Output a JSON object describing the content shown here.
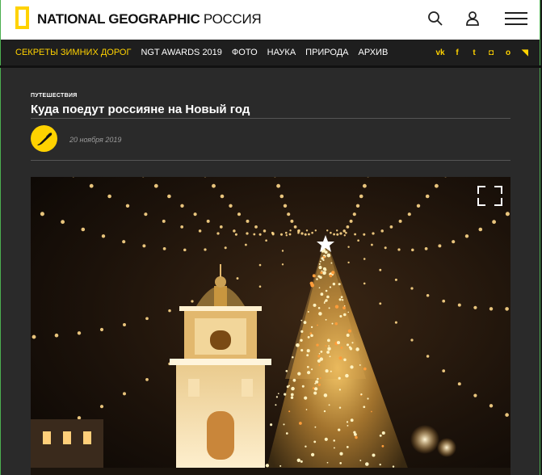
{
  "header": {
    "logo_main": "NATIONAL GEOGRAPHIC",
    "logo_region": "РОССИЯ",
    "colors": {
      "brand_yellow": "#ffd200",
      "nav_bg": "#1e1e1e",
      "content_bg": "#2a2a2a"
    },
    "icons": [
      "search-icon",
      "user-icon",
      "hamburger-menu-icon"
    ]
  },
  "nav": {
    "items": [
      {
        "label": "СЕКРЕТЫ ЗИМНИХ ДОРОГ",
        "active": true
      },
      {
        "label": "NGT AWARDS 2019"
      },
      {
        "label": "ФОТО"
      },
      {
        "label": "НАУКА"
      },
      {
        "label": "ПРИРОДА"
      },
      {
        "label": "АРХИВ"
      }
    ],
    "social": [
      {
        "icon": "vk-icon",
        "glyph": "vk"
      },
      {
        "icon": "facebook-icon",
        "glyph": "f"
      },
      {
        "icon": "twitter-icon",
        "glyph": "t"
      },
      {
        "icon": "instagram-icon",
        "glyph": "◘"
      },
      {
        "icon": "odnoklassniki-icon",
        "glyph": "o"
      },
      {
        "icon": "rss-icon",
        "glyph": "◥"
      }
    ]
  },
  "article": {
    "category": "ПУТЕШЕСТВИЯ",
    "title": "Куда поедут россияне на Новый год",
    "date": "20 ноября 2019"
  }
}
